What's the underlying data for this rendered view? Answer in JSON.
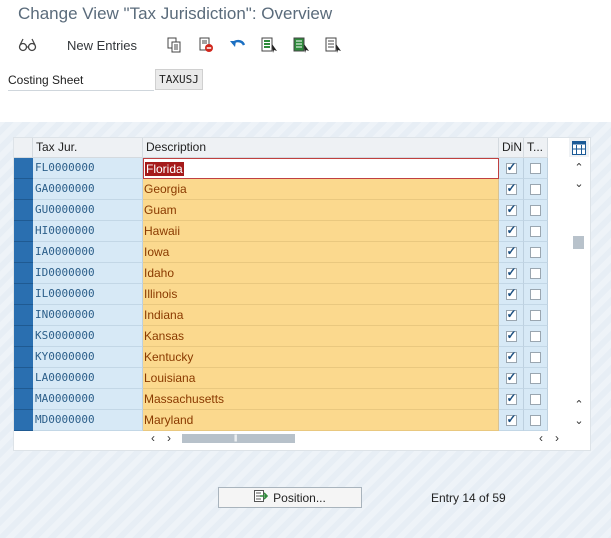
{
  "window": {
    "title": "Change View \"Tax Jurisdiction\": Overview"
  },
  "toolbar": {
    "new_entries_label": "New Entries",
    "icons": [
      "glasses-icon",
      "copy-icon",
      "delete-icon",
      "undo-icon",
      "select-all-icon",
      "select-block-icon",
      "deselect-all-icon"
    ]
  },
  "form": {
    "costing_sheet_label": "Costing Sheet",
    "costing_sheet_value": "TAXUSJ"
  },
  "table": {
    "headers": {
      "tax_jur": "Tax Jur.",
      "description": "Description",
      "din": "DiN",
      "t": "T..."
    },
    "rows": [
      {
        "code": "FL0000000",
        "description": "Florida",
        "din": true,
        "t": false
      },
      {
        "code": "GA0000000",
        "description": "Georgia",
        "din": true,
        "t": false
      },
      {
        "code": "GU0000000",
        "description": "Guam",
        "din": true,
        "t": false
      },
      {
        "code": "HI0000000",
        "description": "Hawaii",
        "din": true,
        "t": false
      },
      {
        "code": "IA0000000",
        "description": "Iowa",
        "din": true,
        "t": false
      },
      {
        "code": "ID0000000",
        "description": "Idaho",
        "din": true,
        "t": false
      },
      {
        "code": "IL0000000",
        "description": "Illinois",
        "din": true,
        "t": false
      },
      {
        "code": "IN0000000",
        "description": "Indiana",
        "din": true,
        "t": false
      },
      {
        "code": "KS0000000",
        "description": "Kansas",
        "din": true,
        "t": false
      },
      {
        "code": "KY0000000",
        "description": "Kentucky",
        "din": true,
        "t": false
      },
      {
        "code": "LA0000000",
        "description": "Louisiana",
        "din": true,
        "t": false
      },
      {
        "code": "MA0000000",
        "description": "Massachusetts",
        "din": true,
        "t": false
      },
      {
        "code": "MD0000000",
        "description": "Maryland",
        "din": true,
        "t": false
      }
    ]
  },
  "footer": {
    "position_button_label": "Position...",
    "entry_text": "Entry 14 of 59"
  },
  "colors": {
    "selection_blue": "#2a6fb0",
    "key_cell_blue": "#d7e9f6",
    "editable_yellow": "#fbd98e",
    "text_dark_red": "#8a3a00"
  }
}
